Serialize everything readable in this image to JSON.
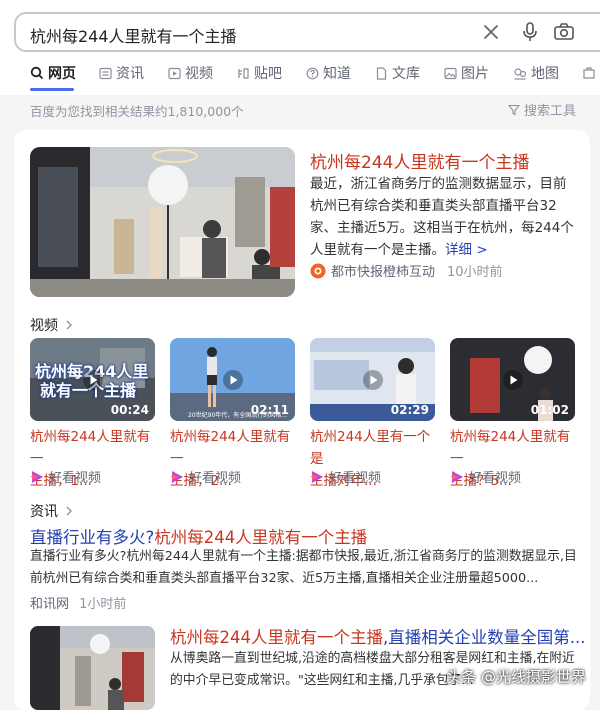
{
  "search": {
    "query": "杭州每244人里就有一个主播"
  },
  "tabs": [
    {
      "label": "网页",
      "icon": "search-icon",
      "active": true
    },
    {
      "label": "资讯",
      "icon": "news-icon"
    },
    {
      "label": "视频",
      "icon": "video-icon"
    },
    {
      "label": "贴吧",
      "icon": "tieba-icon"
    },
    {
      "label": "知道",
      "icon": "question-icon"
    },
    {
      "label": "文库",
      "icon": "document-icon"
    },
    {
      "label": "图片",
      "icon": "image-icon"
    },
    {
      "label": "地图",
      "icon": "map-icon"
    }
  ],
  "result_count": "百度为您找到相关结果约1,810,000个",
  "search_tools": "搜索工具",
  "top_result": {
    "title": "杭州每244人里就有一个主播",
    "snippet": "最近，浙江省商务厅的监测数据显示，目前杭州已有综合类和垂直类头部直播平台32家、主播近5万。这相当于在杭州，每244个人里就有一个是主播。",
    "more": "详细 >",
    "source": "都市快报橙柿互动",
    "time": "10小时前"
  },
  "videos_label": "视频",
  "videos": [
    {
      "title_line1": "杭州每244人里就有一",
      "title_line2": "主播，1...",
      "duration": "00:24",
      "source": "好看视频",
      "thumb_line1": "杭州每244人里",
      "thumb_line2": "就有一个主播"
    },
    {
      "title_line1": "杭州每244人里就有一",
      "title_line2": "主播，2...",
      "duration": "02:11",
      "source": "好看视频",
      "caption": "20世纪90年代，有全国流行的风格..."
    },
    {
      "title_line1": "杭州244人里有一个是",
      "title_line2": "主播对年...",
      "duration": "02:29",
      "source": "好看视频"
    },
    {
      "title_line1": "杭州每244人里就有一",
      "title_line2": "主播？5...",
      "duration": "01:02",
      "source": "好看视频"
    }
  ],
  "news_label": "资讯",
  "news_result": {
    "title_pre": "直播行业有多火?",
    "title_hl": "杭州每244人里就有一个主播",
    "snippet_line1": "直播行业有多火?杭州每244人里就有一个主播:据都市快报,最近,浙江省商务厅的监测数据显示,目",
    "snippet_line2": "前杭州已有综合类和垂直类头部直播平台32家、近5万主播,直播相关企业注册量超5000...",
    "source": "和讯网",
    "time": "1小时前"
  },
  "third_result": {
    "title_hl": "杭州每244人里就有一个主播",
    "title_rest": ",直播相关企业数量全国第...",
    "snippet_line1": "从博奥路一直到世纪城,沿途的高档楼盘大部分租客是网红和主播,在附近",
    "snippet_line2": "的中介早已变成常识。\"这些网红和主播,几乎承包了..."
  },
  "watermark": "头条 @光线摄影世界",
  "colors": {
    "accent": "#4e6ef2",
    "title_red": "#c7361f",
    "link_blue": "#2440b3",
    "meta_gray": "#9195a3"
  }
}
